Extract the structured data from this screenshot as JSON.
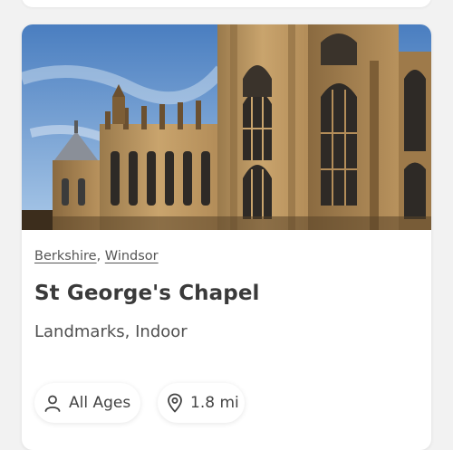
{
  "card": {
    "location": {
      "county": "Berkshire",
      "separator": ",",
      "town": "Windsor"
    },
    "title": "St George's Chapel",
    "categories": "Landmarks, Indoor",
    "chips": {
      "age": {
        "label": "All Ages",
        "icon": "person-icon"
      },
      "distance": {
        "label": "1.8 mi",
        "icon": "map-pin-icon"
      }
    },
    "image": {
      "subject": "gothic-chapel-photo"
    }
  },
  "colors": {
    "sky_top": "#4a7ec0",
    "sky_bottom": "#a9c8e8",
    "stone_light": "#c9a46d",
    "stone_mid": "#a98452",
    "stone_dark": "#6b5030",
    "text_primary": "#3a3a3a",
    "text_secondary": "#555555"
  }
}
